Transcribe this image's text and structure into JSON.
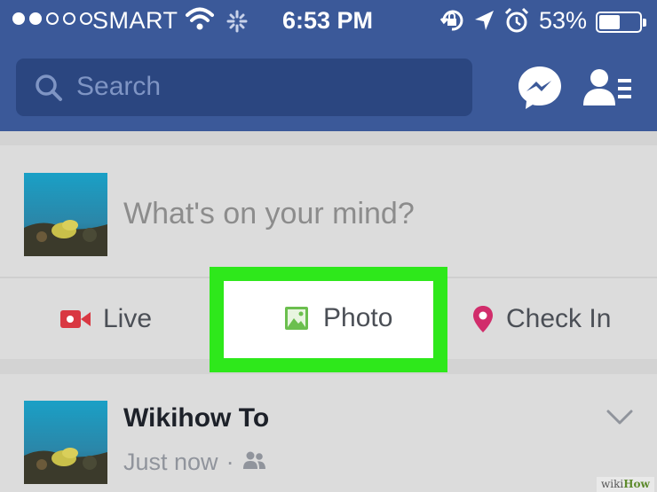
{
  "status_bar": {
    "carrier": "SMART",
    "signal_bars_filled": 2,
    "signal_bars_total": 5,
    "time": "6:53 PM",
    "battery_percent": "53%",
    "battery_level": 0.53
  },
  "nav": {
    "search_placeholder": "Search",
    "icons": [
      "search-icon",
      "messenger-icon",
      "friend-requests-icon"
    ]
  },
  "composer": {
    "placeholder": "What's on your mind?",
    "actions": [
      {
        "label": "Live",
        "icon": "video-camera-icon",
        "color": "#d93842"
      },
      {
        "label": "Photo",
        "icon": "photo-icon",
        "color": "#6bbf4e"
      },
      {
        "label": "Check In",
        "icon": "location-pin-icon",
        "color": "#d12d6b"
      }
    ],
    "highlight_color": "#2ee81b"
  },
  "post": {
    "author": "Wikihow To",
    "time": "Just now",
    "separator": "·",
    "audience_icon": "friends-icon"
  },
  "theme": {
    "brand_blue": "#3b5999",
    "search_bg": "#2b4680"
  },
  "watermark": {
    "part1": "wiki",
    "part2": "How"
  }
}
